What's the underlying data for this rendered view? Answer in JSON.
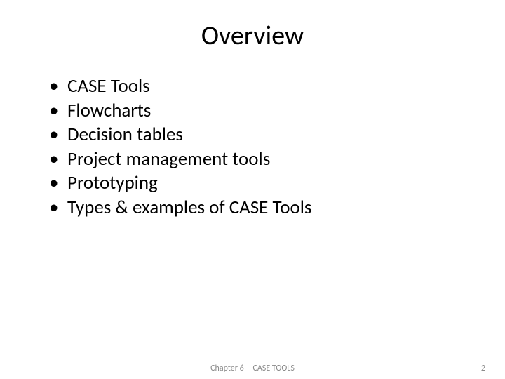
{
  "title": "Overview",
  "bullets": [
    "CASE Tools",
    "Flowcharts",
    "Decision tables",
    "Project management tools",
    "Prototyping",
    "Types & examples of CASE Tools"
  ],
  "footer": {
    "center": "Chapter 6 -- CASE TOOLS",
    "page": "2"
  }
}
